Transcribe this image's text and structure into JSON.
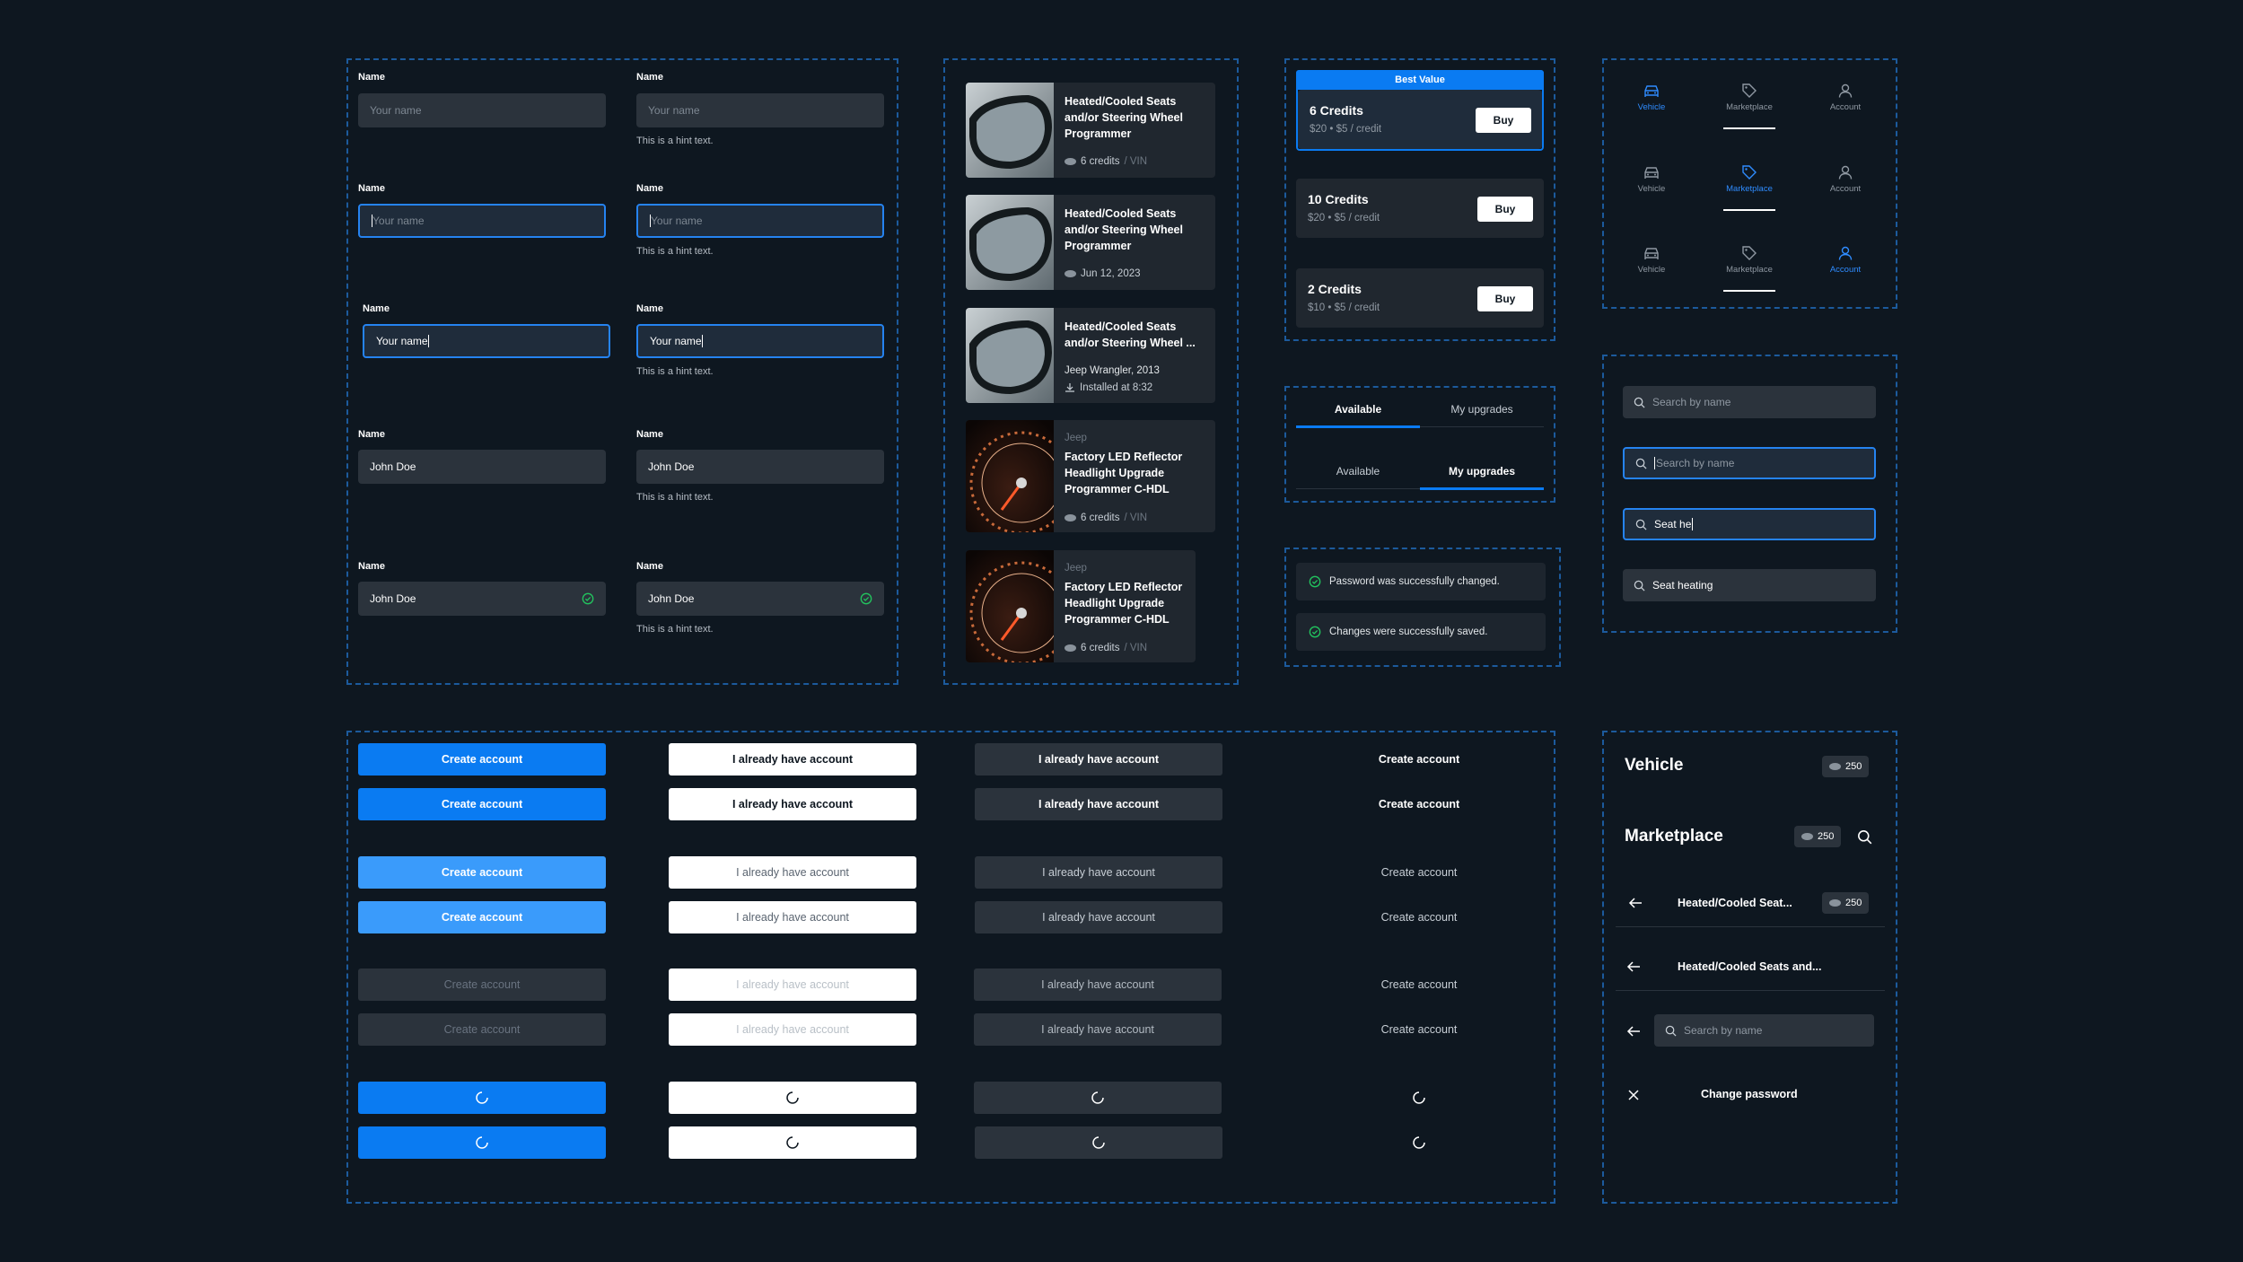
{
  "form": {
    "label": "Name",
    "placeholder": "Your name",
    "hint": "This is a hint text.",
    "typed": "Your name",
    "filled": "John Doe"
  },
  "products": [
    {
      "title": "Heated/Cooled Seats and/or Steering Wheel Programmer",
      "meta_value": "6 credits",
      "meta_suffix": "/ VIN"
    },
    {
      "title": "Heated/Cooled Seats and/or Steering Wheel Programmer",
      "meta_value": "Jun 12, 2023"
    },
    {
      "title": "Heated/Cooled Seats and/or Steering Wheel ...",
      "vehicle": "Jeep Wrangler, 2013",
      "installed": "Installed at 8:32"
    },
    {
      "brand": "Jeep",
      "title": "Factory LED Reflector Headlight Upgrade Programmer C-HDL",
      "meta_value": "6 credits",
      "meta_suffix": "/ VIN"
    },
    {
      "brand": "Jeep",
      "title": "Factory LED Reflector Headlight Upgrade Programmer C-HDL",
      "meta_value": "6 credits",
      "meta_suffix": "/ VIN"
    }
  ],
  "credits": {
    "badge": "Best Value",
    "buy_label": "Buy",
    "packs": [
      {
        "title": "6 Credits",
        "sub": "$20 • $5 / credit"
      },
      {
        "title": "10 Credits",
        "sub": "$20 • $5 / credit"
      },
      {
        "title": "2 Credits",
        "sub": "$10 • $5 / credit"
      }
    ]
  },
  "tabs": {
    "available": "Available",
    "upgrades": "My upgrades"
  },
  "toasts": [
    "Password was successfully changed.",
    "Changes were successfully saved."
  ],
  "nav": {
    "vehicle": "Vehicle",
    "marketplace": "Marketplace",
    "account": "Account"
  },
  "search": {
    "placeholder": "Search by name",
    "typing": "Seat he",
    "value": "Seat heating"
  },
  "buttons": {
    "create": "Create account",
    "have": "I already have account"
  },
  "headers": {
    "vehicle": "Vehicle",
    "marketplace": "Marketplace",
    "balance": "250",
    "product_short": "Heated/Cooled Seat...",
    "product_long": "Heated/Cooled Seats and...",
    "search_placeholder": "Search by name",
    "change_password": "Change password"
  },
  "colors": {
    "accent": "#0a7bf2",
    "success": "#22c55e",
    "background": "#0e1720",
    "surface": "#2b333c"
  }
}
